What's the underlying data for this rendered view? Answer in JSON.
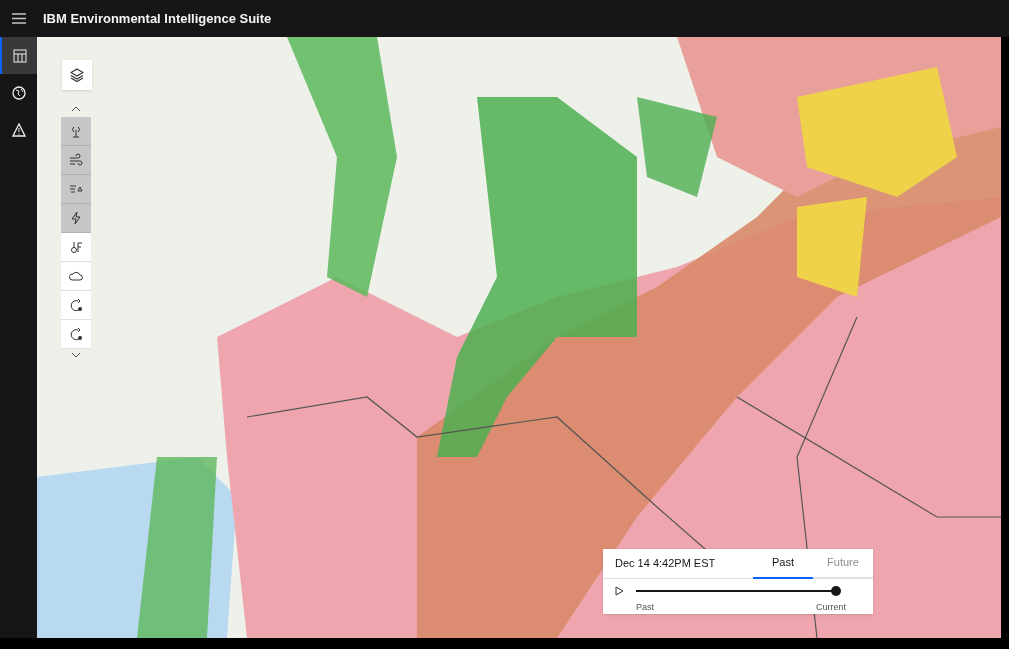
{
  "header": {
    "title": "IBM Environmental Intelligence Suite"
  },
  "nav": [
    {
      "kind": "dashboard",
      "selected": true
    },
    {
      "kind": "globe",
      "selected": false
    },
    {
      "kind": "alert",
      "selected": false
    }
  ],
  "map_tools": [
    {
      "kind": "tower",
      "selected": true
    },
    {
      "kind": "wind",
      "selected": true
    },
    {
      "kind": "storm",
      "selected": true
    },
    {
      "kind": "lightning",
      "selected": true
    },
    {
      "kind": "temperature",
      "selected": false
    },
    {
      "kind": "cloud",
      "selected": false
    },
    {
      "kind": "forecast",
      "selected": false
    },
    {
      "kind": "forecast",
      "selected": false
    }
  ],
  "timeline": {
    "time": "Dec 14 4:42PM EST",
    "tabs": [
      {
        "label": "Past",
        "selected": true
      },
      {
        "label": "Future",
        "selected": false
      }
    ],
    "level": 1,
    "start_label": "Past",
    "end_label": "Current"
  }
}
